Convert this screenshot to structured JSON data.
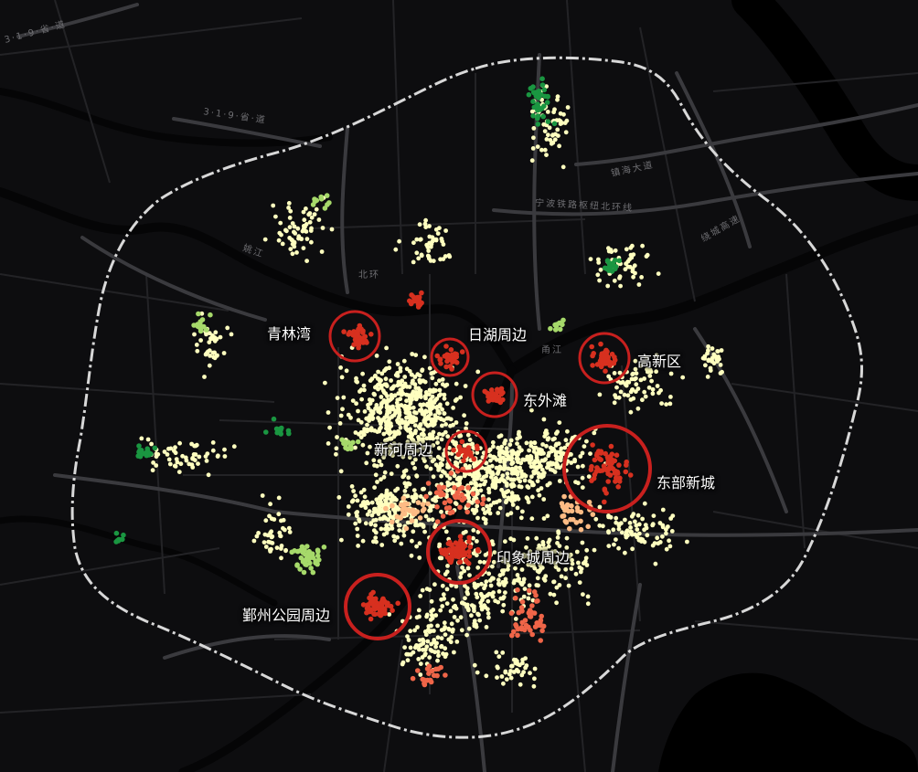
{
  "colors": {
    "background": "#0d0d0f",
    "road_major": "#3a3a3e",
    "road_minor": "#232326",
    "river": "#050506",
    "ring_road": "#d8d8d8",
    "hotspot_circle": "#c8201e",
    "dot_high": "#d7301f",
    "dot_mid_high": "#ef6548",
    "dot_mid": "#fdbb84",
    "dot_low": "#ffffbf",
    "dot_lowest_light": "#a6d96a",
    "dot_lowest": "#1a9641"
  },
  "hotspots": [
    {
      "id": "qinglinwan",
      "label": "青林湾"
    },
    {
      "id": "rihu",
      "label": "日湖周边"
    },
    {
      "id": "gaoxinqu",
      "label": "高新区"
    },
    {
      "id": "dongwaitan",
      "label": "东外滩"
    },
    {
      "id": "xinhe",
      "label": "新河周边"
    },
    {
      "id": "dongbuxincheng",
      "label": "东部新城"
    },
    {
      "id": "yinxiangcheng",
      "label": "印象城周边"
    },
    {
      "id": "yinzhou_park",
      "label": "鄞州公园周边"
    }
  ],
  "road_labels": [
    {
      "id": "s319",
      "text": "3·1·9·省·道"
    },
    {
      "id": "s319_west",
      "text": "3·1·9·省·道"
    },
    {
      "id": "ningbo_hub",
      "text": "宁波铁路枢纽北环线"
    },
    {
      "id": "ring_east",
      "text": "绕城高速"
    },
    {
      "id": "yongjiang",
      "text": "甬江"
    },
    {
      "id": "jinjiang",
      "text": "姚江"
    },
    {
      "id": "zhenhai",
      "text": "镇海大道"
    },
    {
      "id": "beihuan",
      "text": "北环"
    }
  ]
}
